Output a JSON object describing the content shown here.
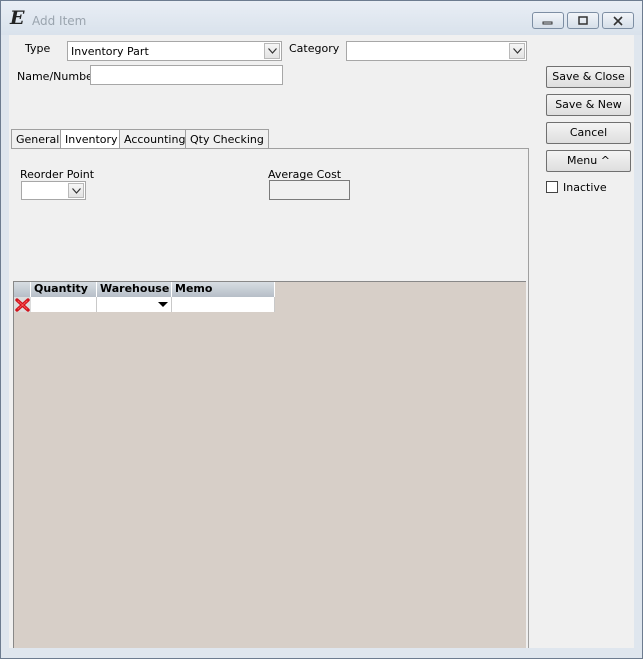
{
  "window": {
    "title": "Add Item",
    "app_icon_glyph": "E"
  },
  "form": {
    "type_label": "Type",
    "type_value": "Inventory Part",
    "category_label": "Category",
    "category_value": "",
    "name_label": "Name/Number",
    "name_value": ""
  },
  "buttons": {
    "save_close": "Save & Close",
    "save_new": "Save & New",
    "cancel": "Cancel",
    "menu": "Menu ^"
  },
  "inactive_label": "Inactive",
  "tabs": [
    {
      "label": "General"
    },
    {
      "label": "Inventory"
    },
    {
      "label": "Accounting"
    },
    {
      "label": "Qty Checking"
    }
  ],
  "inventory": {
    "reorder_point_label": "Reorder Point",
    "reorder_point_value": "",
    "average_cost_label": "Average Cost",
    "average_cost_value": ""
  },
  "grid": {
    "columns": [
      "Quantity",
      "Warehouse",
      "Memo"
    ],
    "rows": [
      {
        "quantity": "",
        "warehouse": "",
        "memo": ""
      }
    ]
  },
  "colors": {
    "grid_background": "#d7cfc8",
    "delete_icon": "#d0121b"
  }
}
